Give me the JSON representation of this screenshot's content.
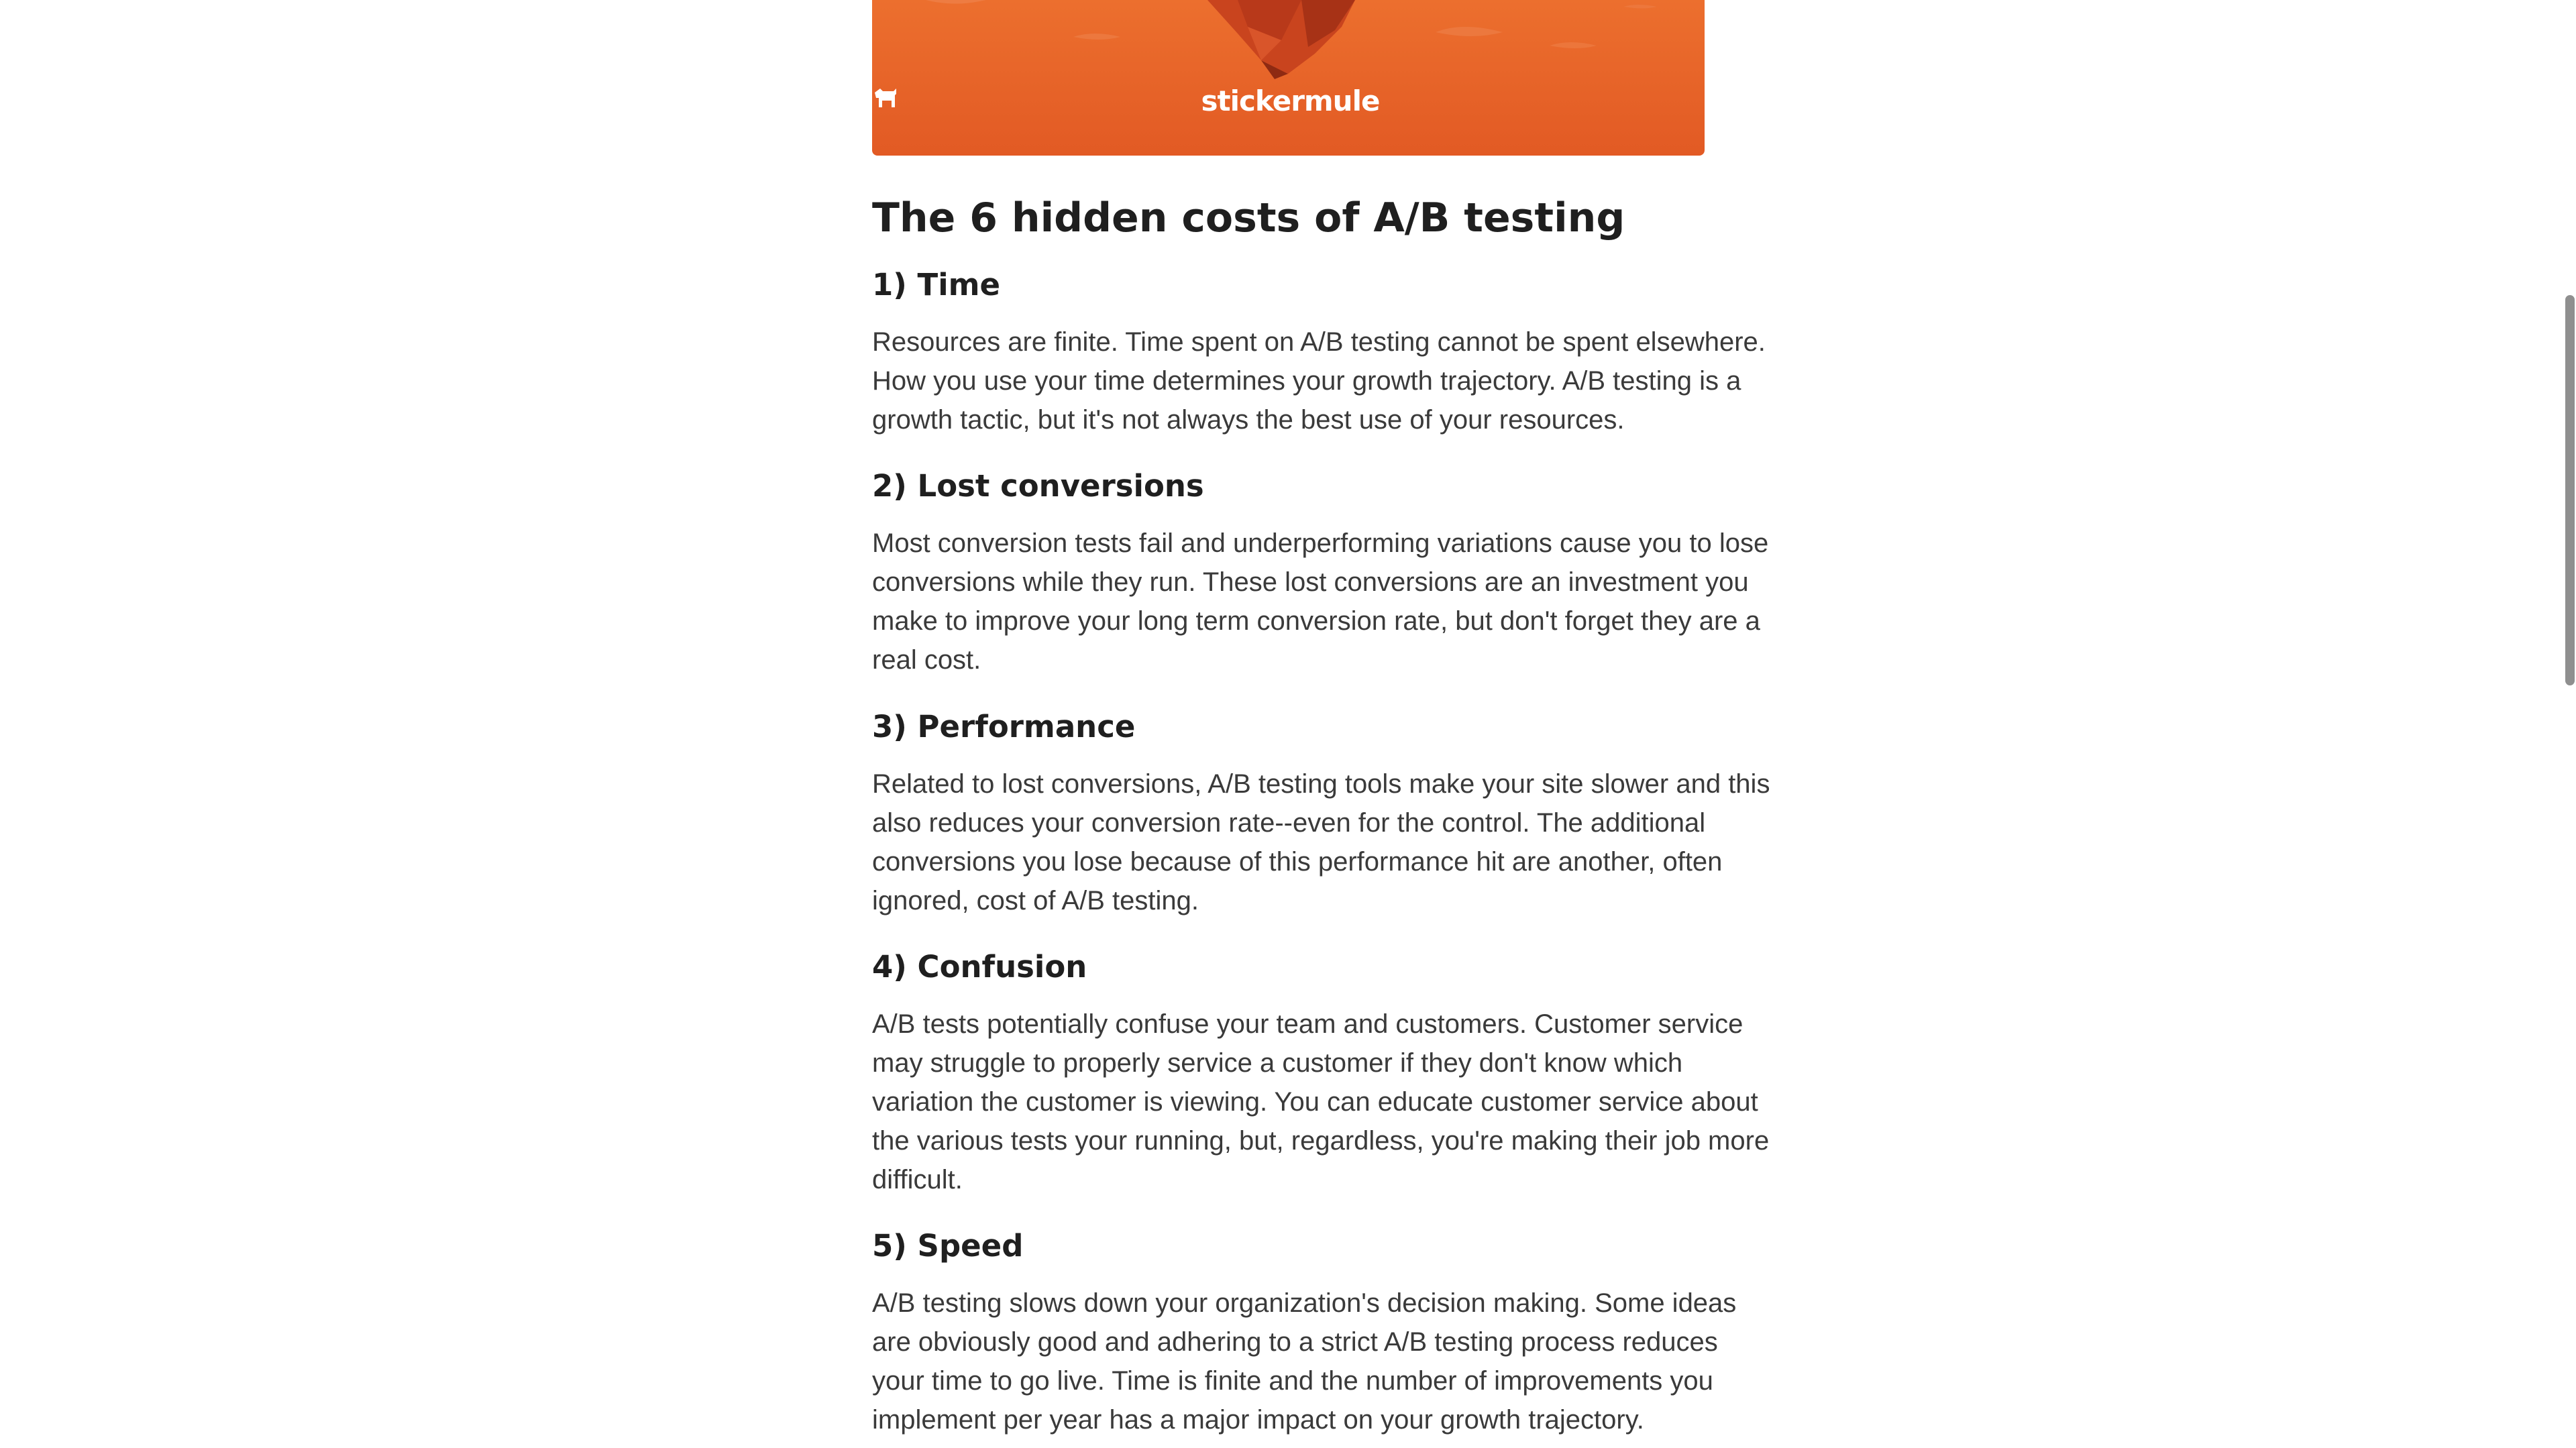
{
  "banner": {
    "brand": "stickermule",
    "colors": {
      "top": "#ec6f2e",
      "bottom": "#e25a24"
    }
  },
  "article": {
    "title": "The 6 hidden costs of A/B testing",
    "sections": [
      {
        "heading": "1) Time",
        "lines": [
          "Resources are finite. Time spent on A/B testing cannot be spent elsewhere.",
          "How you use your time determines your growth trajectory. A/B testing is a",
          "growth tactic, but it's not always the best use of your resources."
        ]
      },
      {
        "heading": "2) Lost conversions",
        "lines": [
          "Most conversion tests fail and underperforming variations cause you to lose",
          "conversions while they run. These lost conversions are an investment you",
          "make to improve your long term conversion rate, but don't forget they are a",
          "real cost."
        ]
      },
      {
        "heading": "3) Performance",
        "lines": [
          "Related to lost conversions, A/B testing tools make your site slower and this",
          "also reduces your conversion rate--even for the control. The additional",
          "conversions you lose because of this performance hit are another, often",
          "ignored, cost of A/B testing."
        ]
      },
      {
        "heading": "4) Confusion",
        "lines": [
          "A/B tests potentially confuse your team and customers. Customer service",
          "may struggle to properly service a customer if they don't know which",
          "variation the customer is viewing. You can educate customer service about",
          "the various tests your running, but, regardless, you're making their job more",
          "difficult."
        ]
      },
      {
        "heading": "5) Speed",
        "lines": [
          "A/B testing slows down your organization's decision making. Some ideas",
          "are obviously good and adhering to a strict A/B testing process reduces",
          "your time to go live. Time is finite and the number of improvements you",
          "implement per year has a major impact on your growth trajectory."
        ]
      }
    ]
  }
}
